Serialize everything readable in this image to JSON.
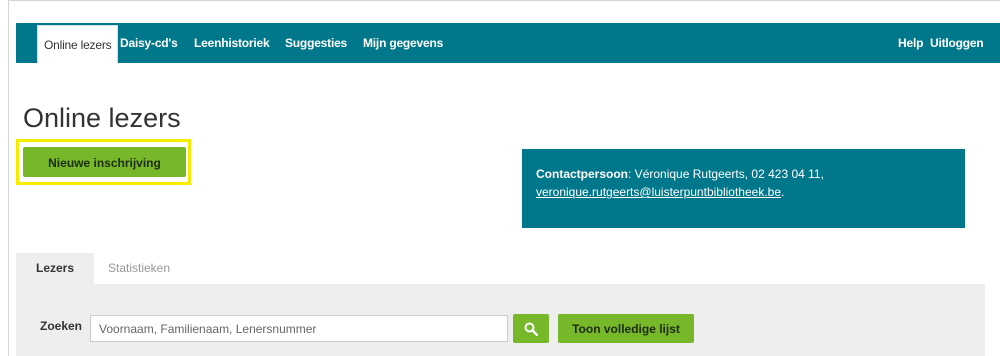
{
  "nav": {
    "left": [
      "Online lezers",
      "Daisy-cd's",
      "Leenhistoriek",
      "Suggesties",
      "Mijn gegevens"
    ],
    "right": [
      "Help",
      "Uitloggen"
    ]
  },
  "page_title": "Online lezers",
  "new_registration_button": "Nieuwe inschrijving",
  "contact": {
    "label": "Contactpersoon",
    "details": ": Véronique Rutgeerts, 02 423 04 11,",
    "email": "veronique.rutgeerts@luisterpuntbibliotheek.be",
    "trailing": "."
  },
  "tabs": [
    "Lezers",
    "Statistieken"
  ],
  "search": {
    "label": "Zoeken",
    "placeholder": "Voornaam, Familienaam, Lenersnummer",
    "full_list_button": "Toon volledige lijst"
  },
  "colors": {
    "nav_bg": "#00778a",
    "button_green": "#76b82a",
    "highlight": "#f5ec00"
  }
}
